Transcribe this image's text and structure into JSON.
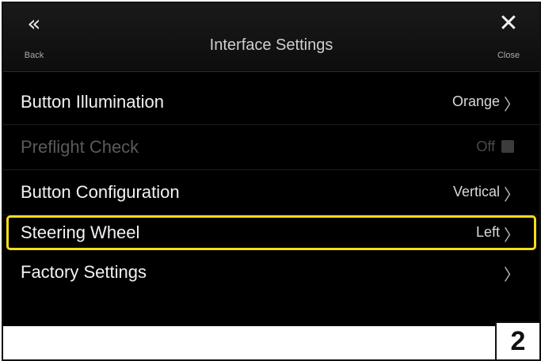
{
  "header": {
    "title": "Interface Settings",
    "back_label": "Back",
    "back_icon": "double-chevron-left-icon",
    "close_label": "Close",
    "close_icon": "close-icon"
  },
  "settings": [
    {
      "label": "Button Illumination",
      "value": "Orange",
      "enabled": true,
      "highlighted": false
    },
    {
      "label": "Preflight Check",
      "value": "Off",
      "enabled": false,
      "highlighted": false
    },
    {
      "label": "Button Configuration",
      "value": "Vertical",
      "enabled": true,
      "highlighted": false
    },
    {
      "label": "Steering Wheel",
      "value": "Left",
      "enabled": true,
      "highlighted": true
    },
    {
      "label": "Factory Settings",
      "value": "",
      "enabled": true,
      "highlighted": false
    }
  ],
  "step_badge": "2",
  "colors": {
    "highlight": "#f4dd1a",
    "screen_bg": "#000000"
  }
}
